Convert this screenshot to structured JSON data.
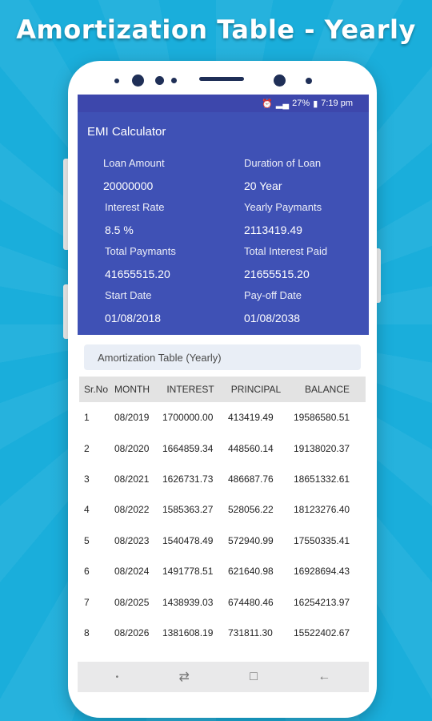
{
  "headline": "Amortization Table - Yearly",
  "statusbar": {
    "icons": [
      "alarm-icon",
      "signal-icon",
      "battery-icon"
    ],
    "battery": "27%",
    "time": "7:19 pm"
  },
  "app": {
    "title": "EMI Calculator"
  },
  "summary": {
    "loan_amount_label": "Loan Amount",
    "loan_amount": "20000000",
    "duration_label": "Duration of Loan",
    "duration": "20 Year",
    "interest_rate_label": "Interest  Rate",
    "interest_rate": "8.5 %",
    "yearly_payments_label": "Yearly  Paymants",
    "yearly_payments": "2113419.49",
    "total_payments_label": "Total Paymants",
    "total_payments": "41655515.20",
    "total_interest_label": "Total Interest Paid",
    "total_interest": "21655515.20",
    "start_date_label": "Start Date",
    "start_date": "01/08/2018",
    "payoff_date_label": "Pay-off Date",
    "payoff_date": "01/08/2038"
  },
  "section_title": "Amortization Table (Yearly)",
  "table": {
    "headers": [
      "Sr.No",
      "MONTH",
      "INTEREST",
      "PRINCIPAL",
      "BALANCE"
    ],
    "rows": [
      [
        "1",
        "08/2019",
        "1700000.00",
        "413419.49",
        "19586580.51"
      ],
      [
        "2",
        "08/2020",
        "1664859.34",
        "448560.14",
        "19138020.37"
      ],
      [
        "3",
        "08/2021",
        "1626731.73",
        "486687.76",
        "18651332.61"
      ],
      [
        "4",
        "08/2022",
        "1585363.27",
        "528056.22",
        "18123276.40"
      ],
      [
        "5",
        "08/2023",
        "1540478.49",
        "572940.99",
        "17550335.41"
      ],
      [
        "6",
        "08/2024",
        "1491778.51",
        "621640.98",
        "16928694.43"
      ],
      [
        "7",
        "08/2025",
        "1438939.03",
        "674480.46",
        "16254213.97"
      ],
      [
        "8",
        "08/2026",
        "1381608.19",
        "731811.30",
        "15522402.67"
      ]
    ]
  },
  "navbar": {
    "icons": [
      "dot-icon",
      "recents-icon",
      "home-icon",
      "back-icon"
    ]
  },
  "colors": {
    "background": "#1aaedb",
    "primary": "#3f51b5",
    "status_bar": "#3d47ac",
    "section_card": "#e9eef6",
    "table_header": "#e3e3e3"
  }
}
